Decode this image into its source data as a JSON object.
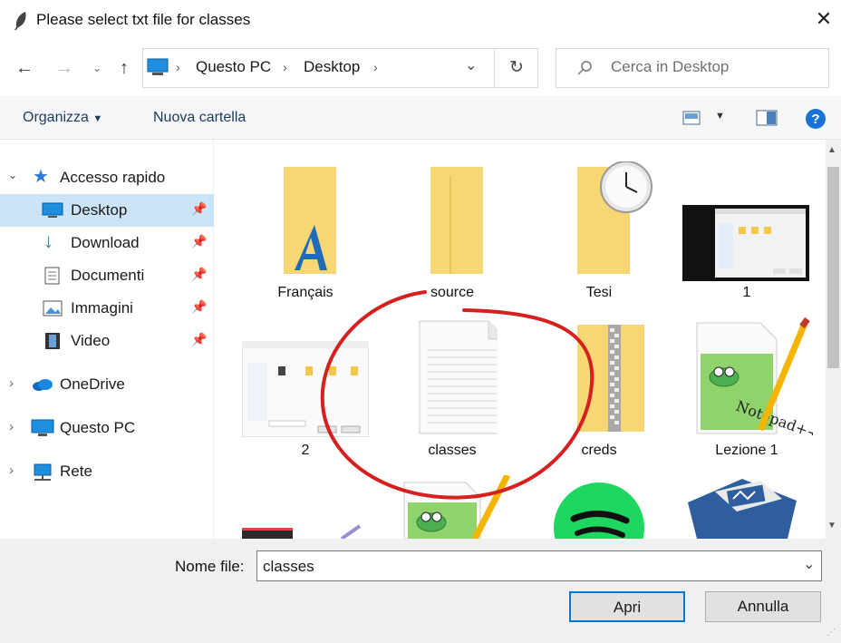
{
  "window": {
    "title": "Please select txt file for classes"
  },
  "nav": {
    "breadcrumb": [
      "Questo PC",
      "Desktop"
    ],
    "search_placeholder": "Cerca in Desktop"
  },
  "toolbar": {
    "organize": "Organizza",
    "new_folder": "Nuova cartella"
  },
  "sidebar": {
    "items": [
      {
        "label": "Accesso rapido"
      },
      {
        "label": "Desktop"
      },
      {
        "label": "Download"
      },
      {
        "label": "Documenti"
      },
      {
        "label": "Immagini"
      },
      {
        "label": "Video"
      },
      {
        "label": "OneDrive"
      },
      {
        "label": "Questo PC"
      },
      {
        "label": "Rete"
      }
    ]
  },
  "files": [
    {
      "name": "Français"
    },
    {
      "name": "source"
    },
    {
      "name": "Tesi"
    },
    {
      "name": "1"
    },
    {
      "name": "2"
    },
    {
      "name": "classes"
    },
    {
      "name": "creds"
    },
    {
      "name": "Lezione 1"
    }
  ],
  "footer": {
    "filename_label": "Nome file:",
    "filename_value": "classes",
    "open": "Apri",
    "cancel": "Annulla"
  }
}
